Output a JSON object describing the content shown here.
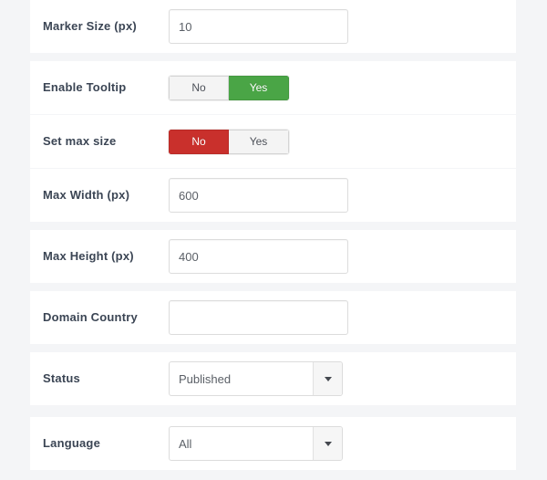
{
  "form": {
    "rows": [
      {
        "label": "Marker Size (px)",
        "type": "text",
        "value": "10",
        "placeholder": "",
        "name": "marker-size"
      },
      {
        "label": "Enable Tooltip",
        "type": "toggle",
        "options": [
          "No",
          "Yes"
        ],
        "selected": "Yes",
        "selected_color": "#4aa546",
        "name": "enable-tooltip"
      },
      {
        "label": "Set max size",
        "type": "toggle",
        "options": [
          "No",
          "Yes"
        ],
        "selected": "No",
        "selected_color": "#c9302c",
        "name": "set-max-size"
      },
      {
        "label": "Max Width (px)",
        "type": "text",
        "value": "600",
        "placeholder": "",
        "name": "max-width"
      },
      {
        "label": "Max Height (px)",
        "type": "text",
        "value": "400",
        "placeholder": "",
        "name": "max-height"
      },
      {
        "label": "Domain Country",
        "type": "text",
        "value": "",
        "placeholder": "",
        "name": "domain-country"
      },
      {
        "label": "Status",
        "type": "select",
        "value": "Published",
        "name": "status"
      },
      {
        "label": "Language",
        "type": "select",
        "value": "All",
        "name": "language"
      }
    ]
  },
  "icons": {
    "caret": "chevron-down-icon"
  },
  "colors": {
    "page_background": "#f4f5f7",
    "row_background": "#ffffff",
    "label_text": "#3b4554",
    "input_border": "#dcdcdc",
    "toggle_yes_active": "#4aa546",
    "toggle_no_active": "#c9302c"
  }
}
